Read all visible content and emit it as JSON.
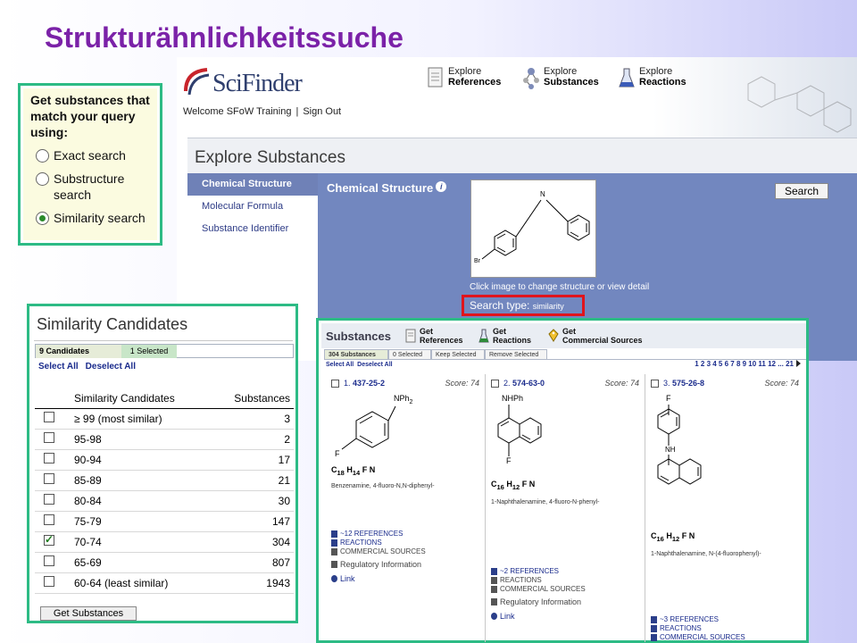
{
  "slide_title": "Strukturähnlichkeitssuche",
  "app": {
    "logo": "SciFinder",
    "welcome": "Welcome SFoW Training",
    "separator": "|",
    "sign_out": "Sign Out",
    "nav": [
      {
        "line1": "Explore",
        "line2": "References"
      },
      {
        "line1": "Explore",
        "line2": "Substances"
      },
      {
        "line1": "Explore",
        "line2": "Reactions"
      }
    ],
    "page_title": "Explore Substances",
    "sidebar": [
      "Chemical Structure",
      "Molecular Formula",
      "Substance Identifier"
    ],
    "chemical_structure_label": "Chemical Structure",
    "search_button": "Search",
    "structure_caption": "Click image to change structure or view detail",
    "search_type_label": "Search type:",
    "search_type_value": "similarity",
    "structure_atoms": {
      "n": "N",
      "br": "Br"
    }
  },
  "query": {
    "heading": "Get substances that match your query using:",
    "options": [
      {
        "label": "Exact search",
        "selected": false
      },
      {
        "label": "Substructure search",
        "selected": false
      },
      {
        "label": "Similarity search",
        "selected": true
      }
    ]
  },
  "similarity": {
    "title": "Similarity Candidates",
    "tab_count": "9 Candidates",
    "tab_selected": "1 Selected",
    "select_all": "Select All",
    "deselect_all": "Deselect All",
    "col_candidates": "Similarity Candidates",
    "col_substances": "Substances",
    "rows": [
      {
        "range": "≥ 99 (most similar)",
        "count": "3",
        "checked": false
      },
      {
        "range": "95-98",
        "count": "2",
        "checked": false
      },
      {
        "range": "90-94",
        "count": "17",
        "checked": false
      },
      {
        "range": "85-89",
        "count": "21",
        "checked": false
      },
      {
        "range": "80-84",
        "count": "30",
        "checked": false
      },
      {
        "range": "75-79",
        "count": "147",
        "checked": false
      },
      {
        "range": "70-74",
        "count": "304",
        "checked": true
      },
      {
        "range": "65-69",
        "count": "807",
        "checked": false
      },
      {
        "range": "60-64 (least similar)",
        "count": "1943",
        "checked": false
      }
    ],
    "get_button": "Get Substances"
  },
  "substances": {
    "title": "Substances",
    "actions": [
      {
        "l1": "Get",
        "l2": "References"
      },
      {
        "l1": "Get",
        "l2": "Reactions"
      },
      {
        "l1": "Get",
        "l2": "Commercial Sources"
      }
    ],
    "tabs": [
      "304 Substances",
      "0 Selected",
      "Keep Selected",
      "Remove Selected"
    ],
    "select_all": "Select All",
    "deselect_all": "Deselect All",
    "pager": "1 2 3 4 5 6 7 8 9 10 11 12 ... 21",
    "results": [
      {
        "index": "1.",
        "rn": "437-25-2",
        "score_label": "Score:",
        "score": "74",
        "subst_top": "NPh",
        "subst_top_sub": "2",
        "subst_bottom": "F",
        "formula_c": "C",
        "formula_c_sub": "18",
        "formula_h": "H",
        "formula_h_sub": "14",
        "formula_rest": "F N",
        "name": "Benzenamine, 4-fluoro-N,N-diphenyl-",
        "refs": "~12 REFERENCES",
        "reactions": "REACTIONS",
        "sources": "COMMERCIAL SOURCES",
        "regulatory": "Regulatory Information",
        "link": "Link"
      },
      {
        "index": "2.",
        "rn": "574-63-0",
        "score_label": "Score:",
        "score": "74",
        "subst_top": "NHPh",
        "subst_top_sub": "",
        "subst_bottom": "F",
        "formula_c": "C",
        "formula_c_sub": "16",
        "formula_h": "H",
        "formula_h_sub": "12",
        "formula_rest": "F N",
        "name": "1-Naphthalenamine, 4-fluoro-N-phenyl-",
        "refs": "~2 REFERENCES",
        "reactions": "REACTIONS",
        "sources": "COMMERCIAL SOURCES",
        "regulatory": "Regulatory Information",
        "link": "Link"
      },
      {
        "index": "3.",
        "rn": "575-26-8",
        "score_label": "Score:",
        "score": "74",
        "subst_top": "F",
        "subst_top_sub": "",
        "subst_bottom": "NH",
        "formula_c": "C",
        "formula_c_sub": "16",
        "formula_h": "H",
        "formula_h_sub": "12",
        "formula_rest": "F N",
        "name": "1-Naphthalenamine, N-(4-fluorophenyl)-",
        "refs": "~3 REFERENCES",
        "reactions": "REACTIONS",
        "sources": "COMMERCIAL SOURCES"
      }
    ]
  },
  "colors": {
    "accent_green": "#2dbb85",
    "title_purple": "#7b22a8",
    "panel_blue": "#7287bf",
    "highlight_red": "#e0141c"
  }
}
